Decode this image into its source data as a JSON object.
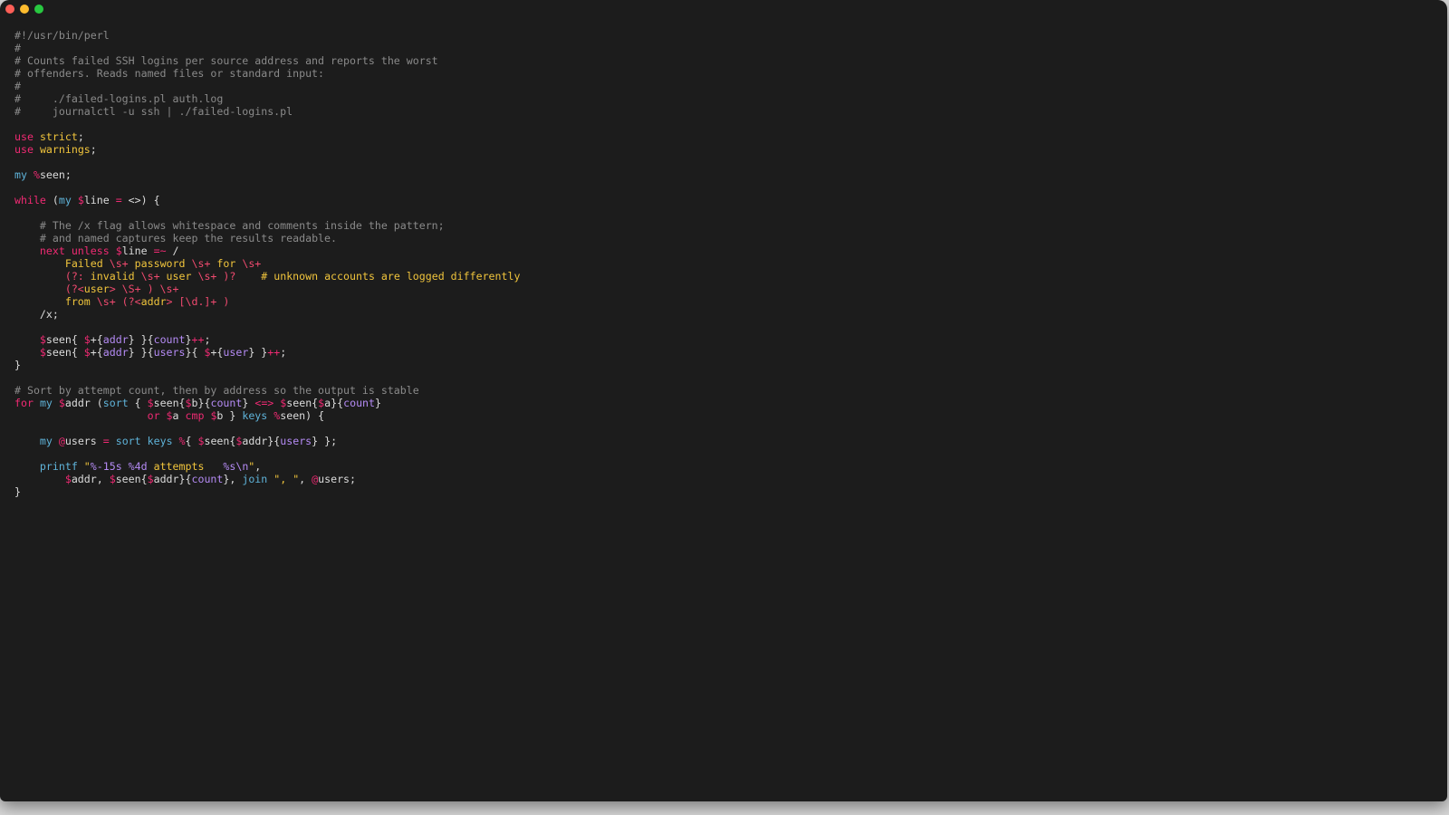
{
  "window": {
    "controls": [
      "close",
      "minimize",
      "zoom"
    ]
  },
  "colors": {
    "background": "#1c1c1c",
    "comment": "#8a8a8a",
    "keyword": "#f02a73",
    "builtin": "#5fb3d9",
    "string": "#f0c43c",
    "hash_key": "#b58bf5",
    "plain": "#dcdcdc"
  },
  "code_lines": [
    [
      {
        "t": "comment",
        "v": "#!/usr/bin/perl"
      }
    ],
    [
      {
        "t": "comment",
        "v": "#"
      }
    ],
    [
      {
        "t": "comment",
        "v": "# Counts failed SSH logins per source address and reports the worst"
      }
    ],
    [
      {
        "t": "comment",
        "v": "# offenders. Reads named files or standard input:"
      }
    ],
    [
      {
        "t": "comment",
        "v": "#"
      }
    ],
    [
      {
        "t": "comment",
        "v": "#     ./failed-logins.pl auth.log"
      }
    ],
    [
      {
        "t": "comment",
        "v": "#     journalctl -u ssh | ./failed-logins.pl"
      }
    ],
    [],
    [
      {
        "t": "keyword",
        "v": "use"
      },
      {
        "t": "plain",
        "v": " "
      },
      {
        "t": "string",
        "v": "strict"
      },
      {
        "t": "plain",
        "v": ";"
      }
    ],
    [
      {
        "t": "keyword",
        "v": "use"
      },
      {
        "t": "plain",
        "v": " "
      },
      {
        "t": "string",
        "v": "warnings"
      },
      {
        "t": "plain",
        "v": ";"
      }
    ],
    [],
    [
      {
        "t": "builtin",
        "v": "my"
      },
      {
        "t": "plain",
        "v": " "
      },
      {
        "t": "sigil",
        "v": "%"
      },
      {
        "t": "plain",
        "v": "seen;"
      }
    ],
    [],
    [
      {
        "t": "keyword",
        "v": "while"
      },
      {
        "t": "plain",
        "v": " ("
      },
      {
        "t": "builtin",
        "v": "my"
      },
      {
        "t": "plain",
        "v": " "
      },
      {
        "t": "sigil",
        "v": "$"
      },
      {
        "t": "plain",
        "v": "line "
      },
      {
        "t": "op",
        "v": "="
      },
      {
        "t": "plain",
        "v": " <>) {"
      }
    ],
    [],
    [
      {
        "t": "plain",
        "v": "    "
      },
      {
        "t": "comment",
        "v": "# The /x flag allows whitespace and comments inside the pattern;"
      }
    ],
    [
      {
        "t": "plain",
        "v": "    "
      },
      {
        "t": "comment",
        "v": "# and named captures keep the results readable."
      }
    ],
    [
      {
        "t": "plain",
        "v": "    "
      },
      {
        "t": "keyword",
        "v": "next"
      },
      {
        "t": "plain",
        "v": " "
      },
      {
        "t": "keyword",
        "v": "unless"
      },
      {
        "t": "plain",
        "v": " "
      },
      {
        "t": "sigil",
        "v": "$"
      },
      {
        "t": "plain",
        "v": "line "
      },
      {
        "t": "op",
        "v": "=~"
      },
      {
        "t": "plain",
        "v": " /"
      }
    ],
    [
      {
        "t": "plain",
        "v": "        "
      },
      {
        "t": "regex",
        "v": "Failed "
      },
      {
        "t": "regexmeta",
        "v": "\\s+"
      },
      {
        "t": "regex",
        "v": " password "
      },
      {
        "t": "regexmeta",
        "v": "\\s+"
      },
      {
        "t": "regex",
        "v": " for "
      },
      {
        "t": "regexmeta",
        "v": "\\s+"
      }
    ],
    [
      {
        "t": "plain",
        "v": "        "
      },
      {
        "t": "regexmeta",
        "v": "(?:"
      },
      {
        "t": "regex",
        "v": " invalid "
      },
      {
        "t": "regexmeta",
        "v": "\\s+"
      },
      {
        "t": "regex",
        "v": " user "
      },
      {
        "t": "regexmeta",
        "v": "\\s+ )?"
      },
      {
        "t": "plain",
        "v": "    "
      },
      {
        "t": "regexcomment",
        "v": "# unknown accounts are logged differently"
      }
    ],
    [
      {
        "t": "plain",
        "v": "        "
      },
      {
        "t": "regexmeta",
        "v": "(?<"
      },
      {
        "t": "regex",
        "v": "user"
      },
      {
        "t": "regexmeta",
        "v": "> \\S+ ) \\s+"
      }
    ],
    [
      {
        "t": "plain",
        "v": "        "
      },
      {
        "t": "regex",
        "v": "from "
      },
      {
        "t": "regexmeta",
        "v": "\\s+ (?<"
      },
      {
        "t": "regex",
        "v": "addr"
      },
      {
        "t": "regexmeta",
        "v": "> [\\d.]+ )"
      }
    ],
    [
      {
        "t": "plain",
        "v": "    /x;"
      }
    ],
    [],
    [
      {
        "t": "plain",
        "v": "    "
      },
      {
        "t": "sigil",
        "v": "$"
      },
      {
        "t": "plain",
        "v": "seen{ "
      },
      {
        "t": "sigil",
        "v": "$"
      },
      {
        "t": "plain",
        "v": "+{"
      },
      {
        "t": "key",
        "v": "addr"
      },
      {
        "t": "plain",
        "v": "} }{"
      },
      {
        "t": "key",
        "v": "count"
      },
      {
        "t": "plain",
        "v": "}"
      },
      {
        "t": "op",
        "v": "++"
      },
      {
        "t": "plain",
        "v": ";"
      }
    ],
    [
      {
        "t": "plain",
        "v": "    "
      },
      {
        "t": "sigil",
        "v": "$"
      },
      {
        "t": "plain",
        "v": "seen{ "
      },
      {
        "t": "sigil",
        "v": "$"
      },
      {
        "t": "plain",
        "v": "+{"
      },
      {
        "t": "key",
        "v": "addr"
      },
      {
        "t": "plain",
        "v": "} }{"
      },
      {
        "t": "key",
        "v": "users"
      },
      {
        "t": "plain",
        "v": "}{ "
      },
      {
        "t": "sigil",
        "v": "$"
      },
      {
        "t": "plain",
        "v": "+{"
      },
      {
        "t": "key",
        "v": "user"
      },
      {
        "t": "plain",
        "v": "} }"
      },
      {
        "t": "op",
        "v": "++"
      },
      {
        "t": "plain",
        "v": ";"
      }
    ],
    [
      {
        "t": "plain",
        "v": "}"
      }
    ],
    [],
    [
      {
        "t": "comment",
        "v": "# Sort by attempt count, then by address so the output is stable"
      }
    ],
    [
      {
        "t": "keyword",
        "v": "for"
      },
      {
        "t": "plain",
        "v": " "
      },
      {
        "t": "builtin",
        "v": "my"
      },
      {
        "t": "plain",
        "v": " "
      },
      {
        "t": "sigil",
        "v": "$"
      },
      {
        "t": "plain",
        "v": "addr ("
      },
      {
        "t": "builtin",
        "v": "sort"
      },
      {
        "t": "plain",
        "v": " { "
      },
      {
        "t": "sigil",
        "v": "$"
      },
      {
        "t": "plain",
        "v": "seen{"
      },
      {
        "t": "sigil",
        "v": "$"
      },
      {
        "t": "plain",
        "v": "b}{"
      },
      {
        "t": "key",
        "v": "count"
      },
      {
        "t": "plain",
        "v": "} "
      },
      {
        "t": "op",
        "v": "<=>"
      },
      {
        "t": "plain",
        "v": " "
      },
      {
        "t": "sigil",
        "v": "$"
      },
      {
        "t": "plain",
        "v": "seen{"
      },
      {
        "t": "sigil",
        "v": "$"
      },
      {
        "t": "plain",
        "v": "a}{"
      },
      {
        "t": "key",
        "v": "count"
      },
      {
        "t": "plain",
        "v": "}"
      }
    ],
    [
      {
        "t": "plain",
        "v": "                     "
      },
      {
        "t": "keyword",
        "v": "or"
      },
      {
        "t": "plain",
        "v": " "
      },
      {
        "t": "sigil",
        "v": "$"
      },
      {
        "t": "plain",
        "v": "a "
      },
      {
        "t": "keyword",
        "v": "cmp"
      },
      {
        "t": "plain",
        "v": " "
      },
      {
        "t": "sigil",
        "v": "$"
      },
      {
        "t": "plain",
        "v": "b } "
      },
      {
        "t": "builtin",
        "v": "keys"
      },
      {
        "t": "plain",
        "v": " "
      },
      {
        "t": "sigil",
        "v": "%"
      },
      {
        "t": "plain",
        "v": "seen) {"
      }
    ],
    [],
    [
      {
        "t": "plain",
        "v": "    "
      },
      {
        "t": "builtin",
        "v": "my"
      },
      {
        "t": "plain",
        "v": " "
      },
      {
        "t": "sigil",
        "v": "@"
      },
      {
        "t": "plain",
        "v": "users "
      },
      {
        "t": "op",
        "v": "="
      },
      {
        "t": "plain",
        "v": " "
      },
      {
        "t": "builtin",
        "v": "sort"
      },
      {
        "t": "plain",
        "v": " "
      },
      {
        "t": "builtin",
        "v": "keys"
      },
      {
        "t": "plain",
        "v": " "
      },
      {
        "t": "sigil",
        "v": "%"
      },
      {
        "t": "plain",
        "v": "{ "
      },
      {
        "t": "sigil",
        "v": "$"
      },
      {
        "t": "plain",
        "v": "seen{"
      },
      {
        "t": "sigil",
        "v": "$"
      },
      {
        "t": "plain",
        "v": "addr}{"
      },
      {
        "t": "key",
        "v": "users"
      },
      {
        "t": "plain",
        "v": "} };"
      }
    ],
    [],
    [
      {
        "t": "plain",
        "v": "    "
      },
      {
        "t": "builtin",
        "v": "printf"
      },
      {
        "t": "plain",
        "v": " "
      },
      {
        "t": "string",
        "v": "\""
      },
      {
        "t": "escape",
        "v": "%-15s %4d"
      },
      {
        "t": "string",
        "v": " attempts   "
      },
      {
        "t": "escape",
        "v": "%s\\n"
      },
      {
        "t": "string",
        "v": "\""
      },
      {
        "t": "plain",
        "v": ","
      }
    ],
    [
      {
        "t": "plain",
        "v": "        "
      },
      {
        "t": "sigil",
        "v": "$"
      },
      {
        "t": "plain",
        "v": "addr, "
      },
      {
        "t": "sigil",
        "v": "$"
      },
      {
        "t": "plain",
        "v": "seen{"
      },
      {
        "t": "sigil",
        "v": "$"
      },
      {
        "t": "plain",
        "v": "addr}{"
      },
      {
        "t": "key",
        "v": "count"
      },
      {
        "t": "plain",
        "v": "}, "
      },
      {
        "t": "builtin",
        "v": "join"
      },
      {
        "t": "plain",
        "v": " "
      },
      {
        "t": "string",
        "v": "\", \""
      },
      {
        "t": "plain",
        "v": ", "
      },
      {
        "t": "sigil",
        "v": "@"
      },
      {
        "t": "plain",
        "v": "users;"
      }
    ],
    [
      {
        "t": "plain",
        "v": "}"
      }
    ]
  ]
}
